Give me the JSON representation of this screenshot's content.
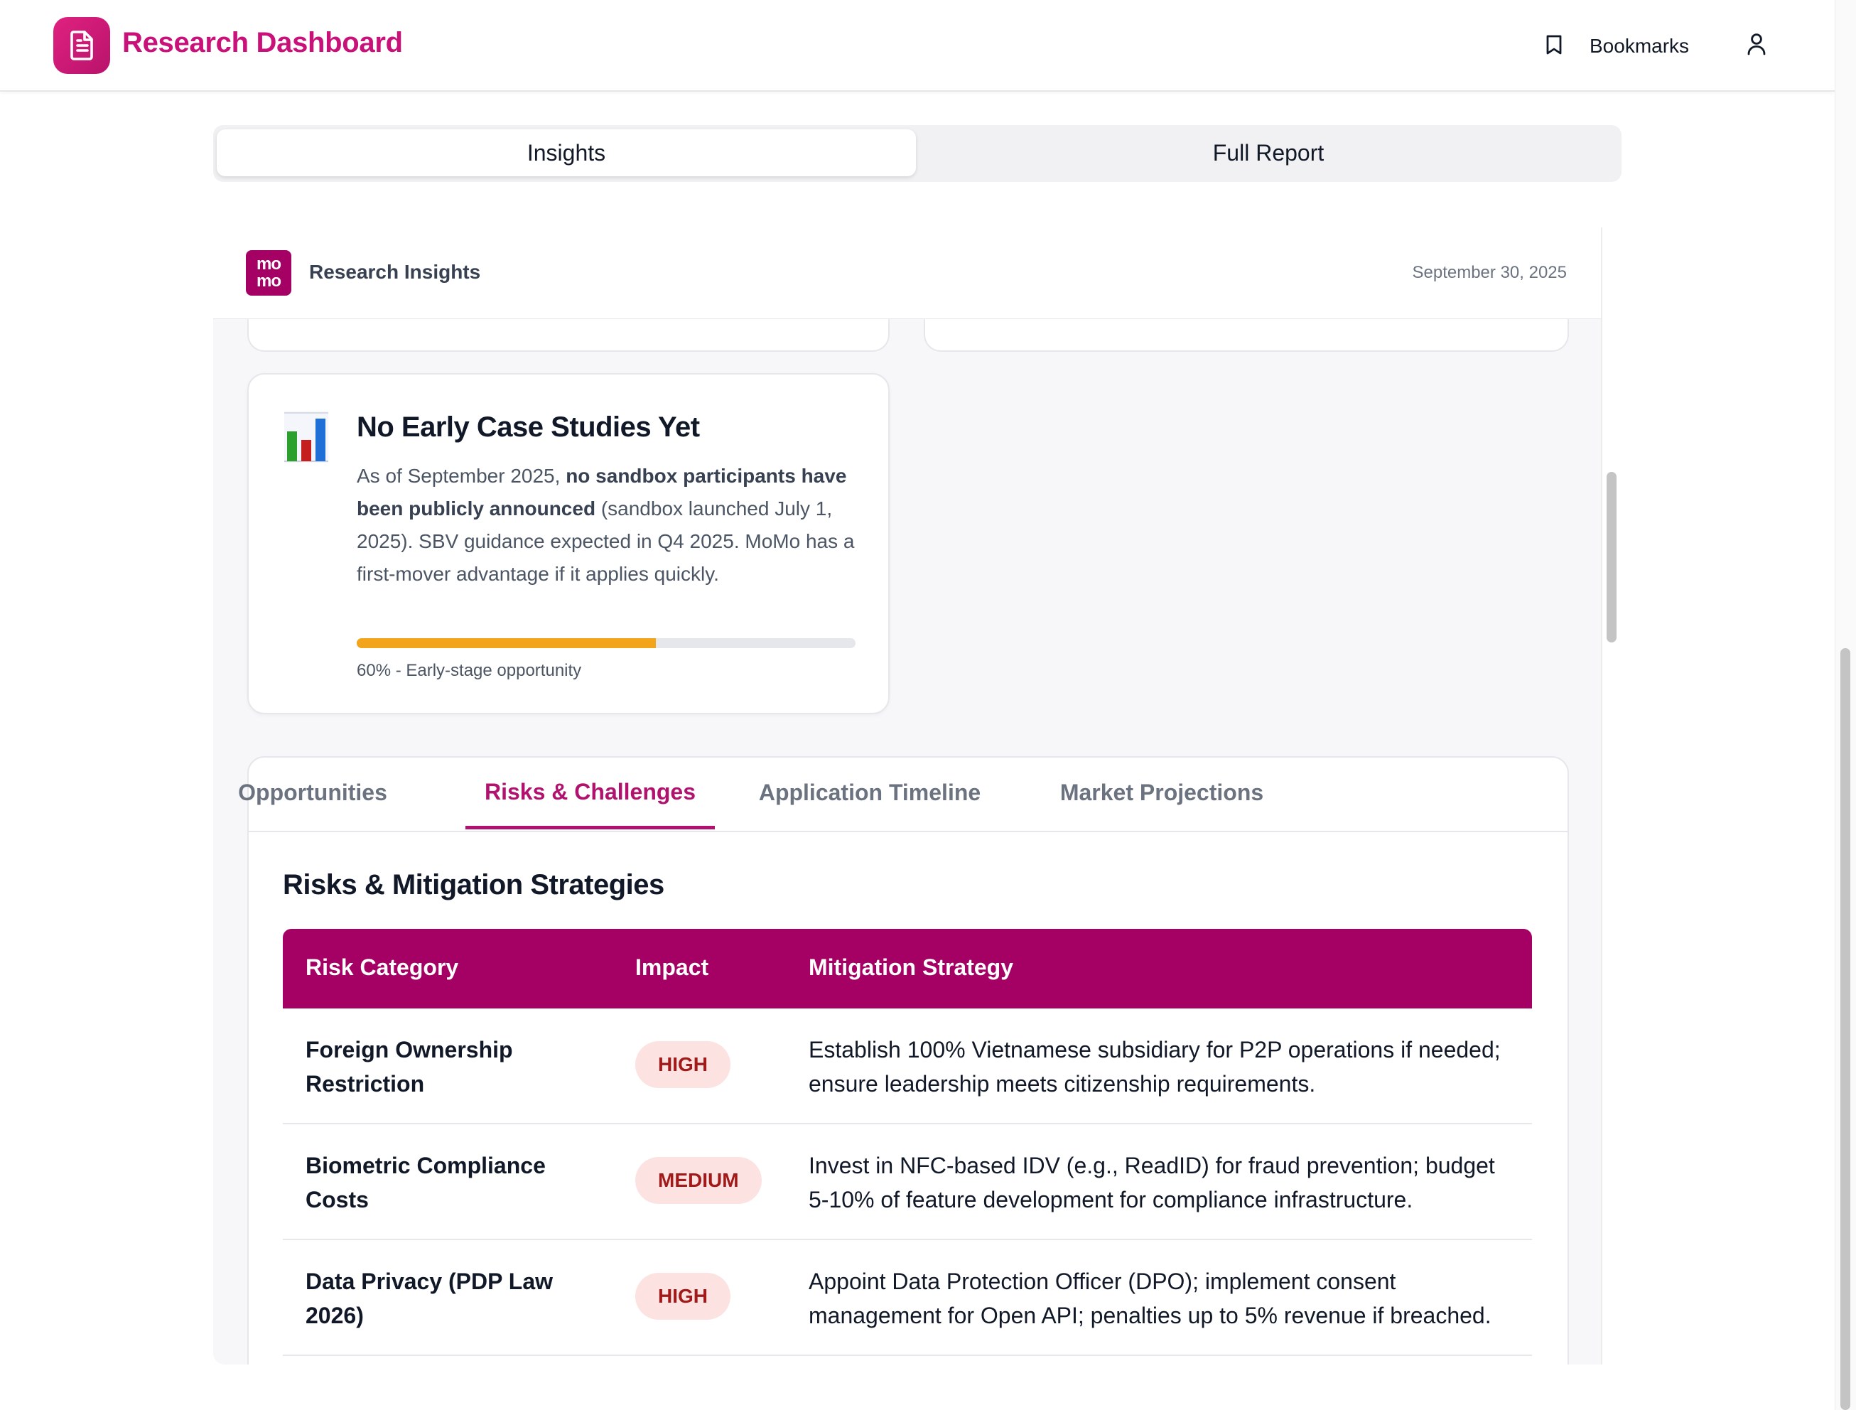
{
  "header": {
    "app_title": "Research Dashboard",
    "bookmarks_label": "Bookmarks"
  },
  "view_toggle": {
    "options": [
      "Insights",
      "Full Report"
    ],
    "selected": "Insights"
  },
  "panel": {
    "brand_badge": [
      "mo",
      "mo"
    ],
    "title": "Research Insights",
    "date": "September 30, 2025"
  },
  "insight_card": {
    "icon": "bar-chart-icon",
    "title": "No Early Case Studies Yet",
    "body_intro": "As of September 2025, ",
    "body_bold": "no sandbox participants have been publicly announced",
    "body_rest": " (sandbox launched July 1, 2025). SBV guidance expected in Q4 2025. MoMo has a first-mover advantage if it applies quickly.",
    "progress_value": 60,
    "progress_label": "60% - Early-stage opportunity",
    "progress_color": "#f2a51a"
  },
  "tabs": {
    "items": [
      "Opportunities",
      "Risks & Challenges",
      "Application Timeline",
      "Market Projections"
    ],
    "active": "Risks & Challenges"
  },
  "risks": {
    "title": "Risks & Mitigation Strategies",
    "columns": [
      "Risk Category",
      "Impact",
      "Mitigation Strategy"
    ],
    "rows": [
      {
        "category": "Foreign Ownership Restriction",
        "impact": "HIGH",
        "mitigation": "Establish 100% Vietnamese subsidiary for P2P operations if needed; ensure leadership meets citizenship requirements."
      },
      {
        "category": "Biometric Compliance Costs",
        "impact": "MEDIUM",
        "mitigation": "Invest in NFC-based IDV (e.g., ReadID) for fraud prevention; budget 5-10% of feature development for compliance infrastructure."
      },
      {
        "category": "Data Privacy (PDP Law 2026)",
        "impact": "HIGH",
        "mitigation": "Appoint Data Protection Officer (DPO); implement consent management for Open API; penalties up to 5% revenue if breached."
      }
    ]
  },
  "colors": {
    "brand": "#c8127a",
    "table_header": "#a50064",
    "badge_bg": "#fde2e2",
    "badge_text": "#a11a1a"
  }
}
